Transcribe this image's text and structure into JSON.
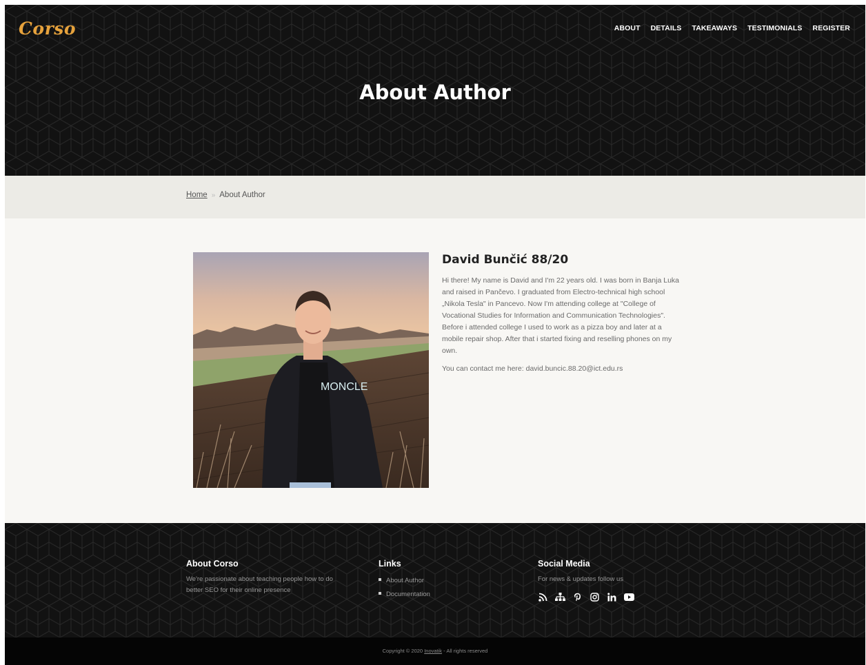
{
  "header": {
    "logo": "Corso",
    "nav": [
      "ABOUT",
      "DETAILS",
      "TAKEAWAYS",
      "TESTIMONIALS",
      "REGISTER"
    ],
    "title": "About Author"
  },
  "breadcrumb": {
    "home": "Home",
    "separator": "»",
    "current": "About Author"
  },
  "author": {
    "name": "David Bunčić 88/20",
    "bio": "Hi there! My name is David and I'm 22 years old. I was born in Banja Luka and raised in Pančevo. I graduated from Electro-technical high school „Nikola Tesla\" in Pancevo. Now I'm attending college at \"College of Vocational Studies for Information and Communication Technologies\". Before i attended college I used to work as a pizza boy and later at a mobile repair shop. After that i started fixing and reselling phones on my own.",
    "contact": "You can contact me here: david.buncic.88.20@ict.edu.rs",
    "shirt_text": "MONCLE"
  },
  "footer": {
    "about": {
      "heading": "About Corso",
      "text": "We're passionate about teaching people how to do better SEO for their online presence"
    },
    "links": {
      "heading": "Links",
      "items": [
        "About Author",
        "Documentation"
      ]
    },
    "social": {
      "heading": "Social Media",
      "text": "For news & updates follow us",
      "icons": [
        "rss-icon",
        "sitemap-icon",
        "pinterest-icon",
        "instagram-icon",
        "linkedin-icon",
        "youtube-icon"
      ]
    },
    "copyright": {
      "prefix": "Copyright © 2020",
      "link": "Inovatik",
      "suffix": "- All rights reserved"
    }
  },
  "colors": {
    "accent": "#e6a23c",
    "dark": "#121212",
    "crumb_bg": "#ecebe6",
    "page_bg": "#f8f7f4"
  }
}
